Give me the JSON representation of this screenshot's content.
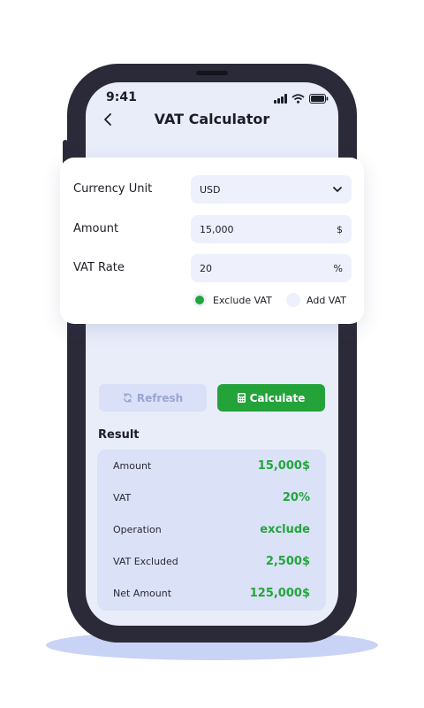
{
  "status_bar": {
    "time": "9:41"
  },
  "header": {
    "title": "VAT Calculator"
  },
  "form": {
    "currency_label": "Currency Unit",
    "currency_value": "USD",
    "amount_label": "Amount",
    "amount_value": "15,000",
    "amount_unit": "$",
    "vat_rate_label": "VAT Rate",
    "vat_rate_value": "20",
    "vat_rate_unit": "%",
    "options": [
      {
        "label": "Exclude VAT",
        "selected": true
      },
      {
        "label": "Add VAT",
        "selected": false
      }
    ]
  },
  "actions": {
    "refresh_label": "Refresh",
    "calculate_label": "Calculate"
  },
  "result": {
    "title": "Result",
    "rows": [
      {
        "label": "Amount",
        "value": "15,000$"
      },
      {
        "label": "VAT",
        "value": "20%"
      },
      {
        "label": "Operation",
        "value": "exclude"
      },
      {
        "label": "VAT Excluded",
        "value": "2,500$"
      },
      {
        "label": "Net Amount",
        "value": "125,000$"
      }
    ]
  },
  "colors": {
    "accent_green": "#24a33a",
    "value_green": "#22a63c",
    "phone_frame": "#2b2a38",
    "screen_bg": "#e9edfa"
  },
  "icons": [
    "chevron-left-icon",
    "signal-icon",
    "wifi-icon",
    "battery-icon",
    "chevron-down-icon",
    "refresh-icon",
    "calculator-icon"
  ]
}
